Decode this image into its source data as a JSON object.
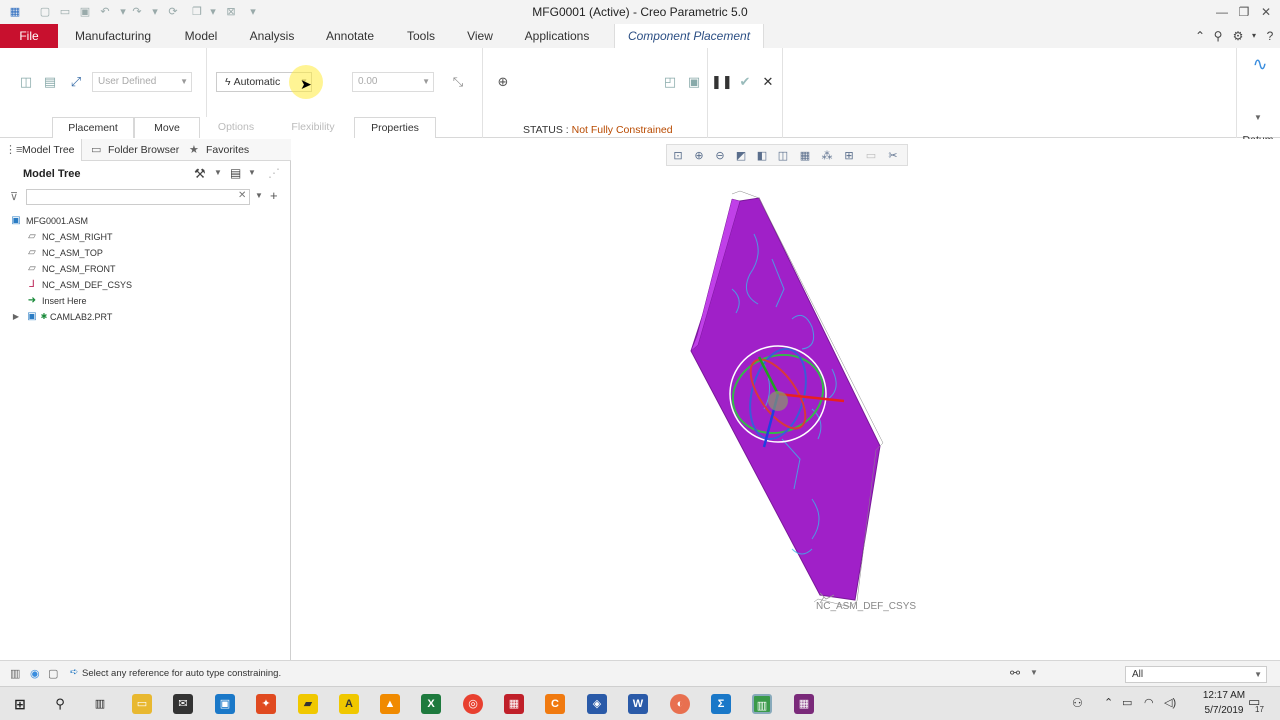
{
  "window": {
    "title": "MFG0001 (Active) - Creo Parametric 5.0"
  },
  "ribbon_tabs": [
    {
      "label": "Manufacturing"
    },
    {
      "label": "Model"
    },
    {
      "label": "Analysis"
    },
    {
      "label": "Annotate"
    },
    {
      "label": "Tools"
    },
    {
      "label": "View"
    },
    {
      "label": "Applications"
    },
    {
      "label": "Component Placement"
    }
  ],
  "file_tab": "File",
  "placement": {
    "constraint_set": "User Defined",
    "constraint_type": "Automatic",
    "offset_value": "0.00",
    "status_label": "STATUS : ",
    "status_value": "Not Fully Constrained",
    "datum_label": "Datum",
    "subtabs": [
      {
        "label": "Placement",
        "enabled": true
      },
      {
        "label": "Move",
        "enabled": true
      },
      {
        "label": "Options",
        "enabled": false
      },
      {
        "label": "Flexibility",
        "enabled": false
      },
      {
        "label": "Properties",
        "enabled": true
      }
    ]
  },
  "left_panel": {
    "tabs": [
      {
        "label": "Model Tree"
      },
      {
        "label": "Folder Browser"
      },
      {
        "label": "Favorites"
      }
    ],
    "tree_title": "Model Tree",
    "filter_placeholder": "",
    "tree_items": [
      {
        "label": "MFG0001.ASM",
        "icon": "assembly-icon",
        "level": 0
      },
      {
        "label": "NC_ASM_RIGHT",
        "icon": "datum-plane-icon",
        "level": 1
      },
      {
        "label": "NC_ASM_TOP",
        "icon": "datum-plane-icon",
        "level": 1
      },
      {
        "label": "NC_ASM_FRONT",
        "icon": "datum-plane-icon",
        "level": 1
      },
      {
        "label": "NC_ASM_DEF_CSYS",
        "icon": "csys-icon",
        "level": 1
      },
      {
        "label": "Insert Here",
        "icon": "insert-arrow-icon",
        "level": 1
      },
      {
        "label": "CAMLAB2.PRT",
        "icon": "part-icon",
        "level": 1
      }
    ]
  },
  "graphics": {
    "csys_label": "NC_ASM_DEF_CSYS",
    "part_color": "#a020c8"
  },
  "status_bar": {
    "message": "Select any reference for auto type constraining.",
    "filter_value": "All"
  },
  "taskbar": {
    "time": "12:17 AM",
    "date": "5/7/2019",
    "notification_count": "17"
  },
  "colors": {
    "file_tab": "#c8102e",
    "accent_blue": "#2c4f84",
    "status_warning": "#b84a00"
  }
}
